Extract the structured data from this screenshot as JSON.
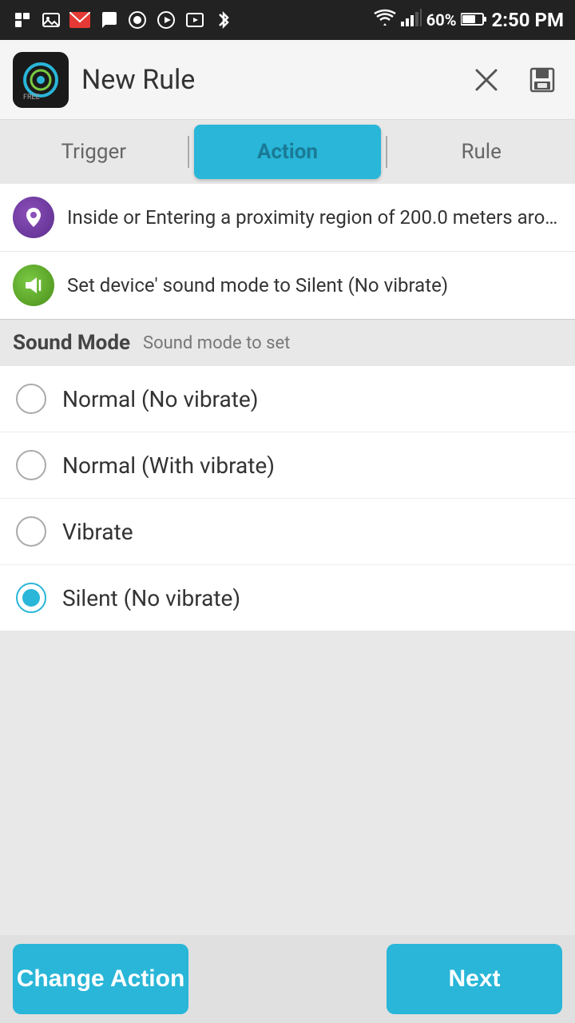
{
  "statusBar": {
    "time": "2:50 PM",
    "battery": "60%"
  },
  "appBar": {
    "title": "New Rule",
    "closeLabel": "×",
    "saveLabel": "💾"
  },
  "tabs": [
    {
      "id": "trigger",
      "label": "Trigger",
      "active": false
    },
    {
      "id": "action",
      "label": "Action",
      "active": true
    },
    {
      "id": "rule",
      "label": "Rule",
      "active": false
    }
  ],
  "infoRows": [
    {
      "id": "trigger-row",
      "iconType": "location",
      "text": "Inside or Entering a proximity region of 200.0 meters aro…"
    },
    {
      "id": "action-row",
      "iconType": "sound",
      "text": "Set device' sound mode to Silent (No vibrate)"
    }
  ],
  "soundModeSection": {
    "title": "Sound Mode",
    "subtitle": "Sound mode to set"
  },
  "options": [
    {
      "id": "normal-no-vibrate",
      "label": "Normal (No vibrate)",
      "selected": false
    },
    {
      "id": "normal-with-vibrate",
      "label": "Normal (With vibrate)",
      "selected": false
    },
    {
      "id": "vibrate",
      "label": "Vibrate",
      "selected": false
    },
    {
      "id": "silent-no-vibrate",
      "label": "Silent (No vibrate)",
      "selected": true
    }
  ],
  "bottomButtons": {
    "changeAction": "Change Action",
    "next": "Next"
  }
}
